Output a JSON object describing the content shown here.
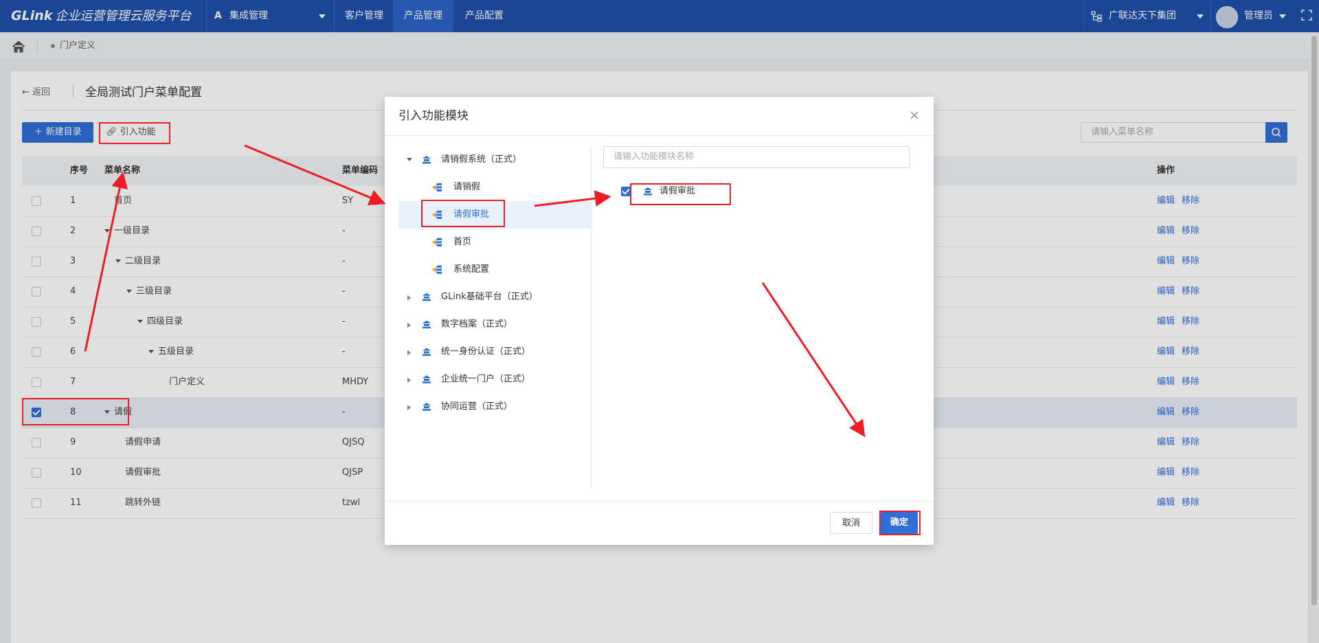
{
  "header": {
    "logo": "GLink",
    "platform_name": "企业运营管理云服务平台",
    "app_switcher": "集成管理",
    "nav": [
      "客户管理",
      "产品管理",
      "产品配置"
    ],
    "active_nav": "产品管理",
    "org": "广联达天下集团",
    "user": "管理员"
  },
  "breadcrumb": {
    "current": "门户定义"
  },
  "page": {
    "back_label": "返回",
    "title": "全局测试门户菜单配置",
    "new_dir_button": "新建目录",
    "import_button": "引入功能",
    "search_placeholder": "请输入菜单名称"
  },
  "table": {
    "columns": {
      "index": "序号",
      "name": "菜单名称",
      "code": "菜单编码",
      "ops": "操作"
    },
    "rows": [
      {
        "index": "1",
        "name": "首页",
        "code": "SY",
        "level": 0,
        "expandable": false,
        "checked": false
      },
      {
        "index": "2",
        "name": "一级目录",
        "code": "-",
        "level": 0,
        "expandable": true,
        "checked": false
      },
      {
        "index": "3",
        "name": "二级目录",
        "code": "-",
        "level": 1,
        "expandable": true,
        "checked": false
      },
      {
        "index": "4",
        "name": "三级目录",
        "code": "-",
        "level": 2,
        "expandable": true,
        "checked": false
      },
      {
        "index": "5",
        "name": "四级目录",
        "code": "-",
        "level": 3,
        "expandable": true,
        "checked": false
      },
      {
        "index": "6",
        "name": "五级目录",
        "code": "-",
        "level": 4,
        "expandable": true,
        "checked": false
      },
      {
        "index": "7",
        "name": "门户定义",
        "code": "MHDY",
        "level": 5,
        "expandable": false,
        "checked": false
      },
      {
        "index": "8",
        "name": "请假",
        "code": "-",
        "level": 0,
        "expandable": true,
        "checked": true
      },
      {
        "index": "9",
        "name": "请假申请",
        "code": "QJSQ",
        "level": 1,
        "expandable": false,
        "checked": false
      },
      {
        "index": "10",
        "name": "请假审批",
        "code": "QJSP",
        "level": 1,
        "expandable": false,
        "checked": false
      },
      {
        "index": "11",
        "name": "跳转外链",
        "code": "tzwl",
        "level": 1,
        "expandable": false,
        "checked": false
      }
    ],
    "edit_label": "编辑",
    "remove_label": "移除"
  },
  "dialog": {
    "title": "引入功能模块",
    "tree": [
      {
        "label": "请销假系统（正式）",
        "type": "system",
        "expanded": true,
        "children": [
          {
            "label": "请销假",
            "selected": false
          },
          {
            "label": "请假审批",
            "selected": true
          },
          {
            "label": "首页",
            "selected": false
          },
          {
            "label": "系统配置",
            "selected": false
          }
        ]
      },
      {
        "label": "GLink基础平台（正式）",
        "type": "system",
        "expanded": false
      },
      {
        "label": "数字档案（正式）",
        "type": "system",
        "expanded": false
      },
      {
        "label": "统一身份认证（正式）",
        "type": "system",
        "expanded": false
      },
      {
        "label": "企业统一门户（正式）",
        "type": "system",
        "expanded": false
      },
      {
        "label": "协同运营（正式）",
        "type": "system",
        "expanded": false
      }
    ],
    "right_search_placeholder": "请输入功能模块名称",
    "selected_items": [
      {
        "label": "请假审批",
        "checked": true
      }
    ],
    "cancel_label": "取消",
    "ok_label": "确定"
  },
  "colors": {
    "header_bg": "#1f4faa",
    "primary": "#2f6ed6",
    "annotation": "#ee1d24"
  }
}
